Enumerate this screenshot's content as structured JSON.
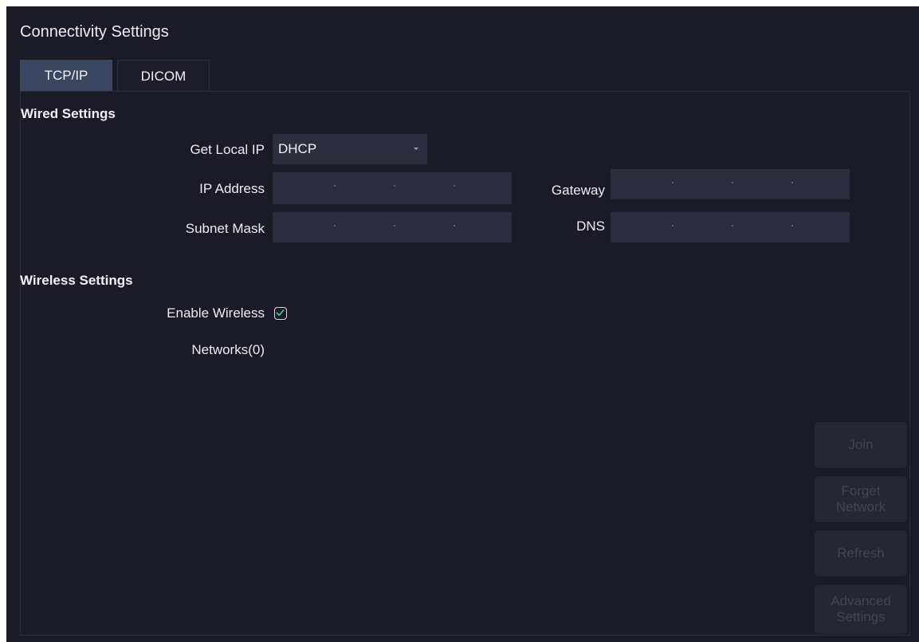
{
  "window": {
    "title": "Connectivity Settings"
  },
  "tabs": [
    {
      "label": "TCP/IP",
      "active": true
    },
    {
      "label": "DICOM",
      "active": false
    }
  ],
  "wired": {
    "section_title": "Wired Settings",
    "get_local_ip": {
      "label": "Get Local IP",
      "value": "DHCP"
    },
    "ip_address": {
      "label": "IP Address",
      "value": ""
    },
    "subnet_mask": {
      "label": "Subnet Mask",
      "value": ""
    },
    "gateway": {
      "label": "Gateway",
      "value": ""
    },
    "dns": {
      "label": "DNS",
      "value": ""
    }
  },
  "wireless": {
    "section_title": "Wireless Settings",
    "enable_label": "Enable Wireless",
    "enabled": true,
    "networks_label": "Networks(0)"
  },
  "actions": {
    "join": "Join",
    "forget_network": "Forget Network",
    "refresh": "Refresh",
    "advanced_settings": "Advanced Settings"
  },
  "colors": {
    "background": "#1b1b27",
    "active_tab": "#39465f",
    "field": "#2c2e40",
    "checkmark": "#3ec27a",
    "disabled_button": "#262735",
    "disabled_text": "#41435a"
  },
  "icons": {
    "dropdown": "chevron-down-icon",
    "checkbox_check": "check-icon"
  }
}
